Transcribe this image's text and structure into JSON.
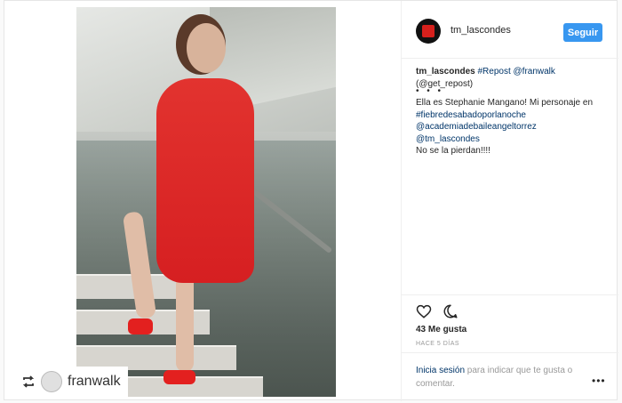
{
  "post": {
    "author": "tm_lascondes",
    "follow_label": "Seguir",
    "repost_credit": "franwalk",
    "caption": {
      "user": "tm_lascondes",
      "line1_tag": "#Repost",
      "line1_mention": "@franwalk",
      "line2": "(@get_repost)",
      "dots": "• • •",
      "line3": "Ella es Stephanie Mangano! Mi personaje en",
      "line4": "#fiebredesabadoporlanoche",
      "line5": "@academiadebaileangeltorrez",
      "line6": "@tm_lascondes",
      "line7": "No se la pierdan!!!!"
    },
    "likes": "43 Me gusta",
    "timestamp": "HACE 5 DÍAS",
    "login_link": "Inicia sesión",
    "login_text_line1": " para indicar que te gusta o",
    "login_text_line2": "comentar.",
    "more": "•••"
  },
  "icons": [
    "repost-icon",
    "heart-icon",
    "comment-icon",
    "more-options-icon"
  ]
}
